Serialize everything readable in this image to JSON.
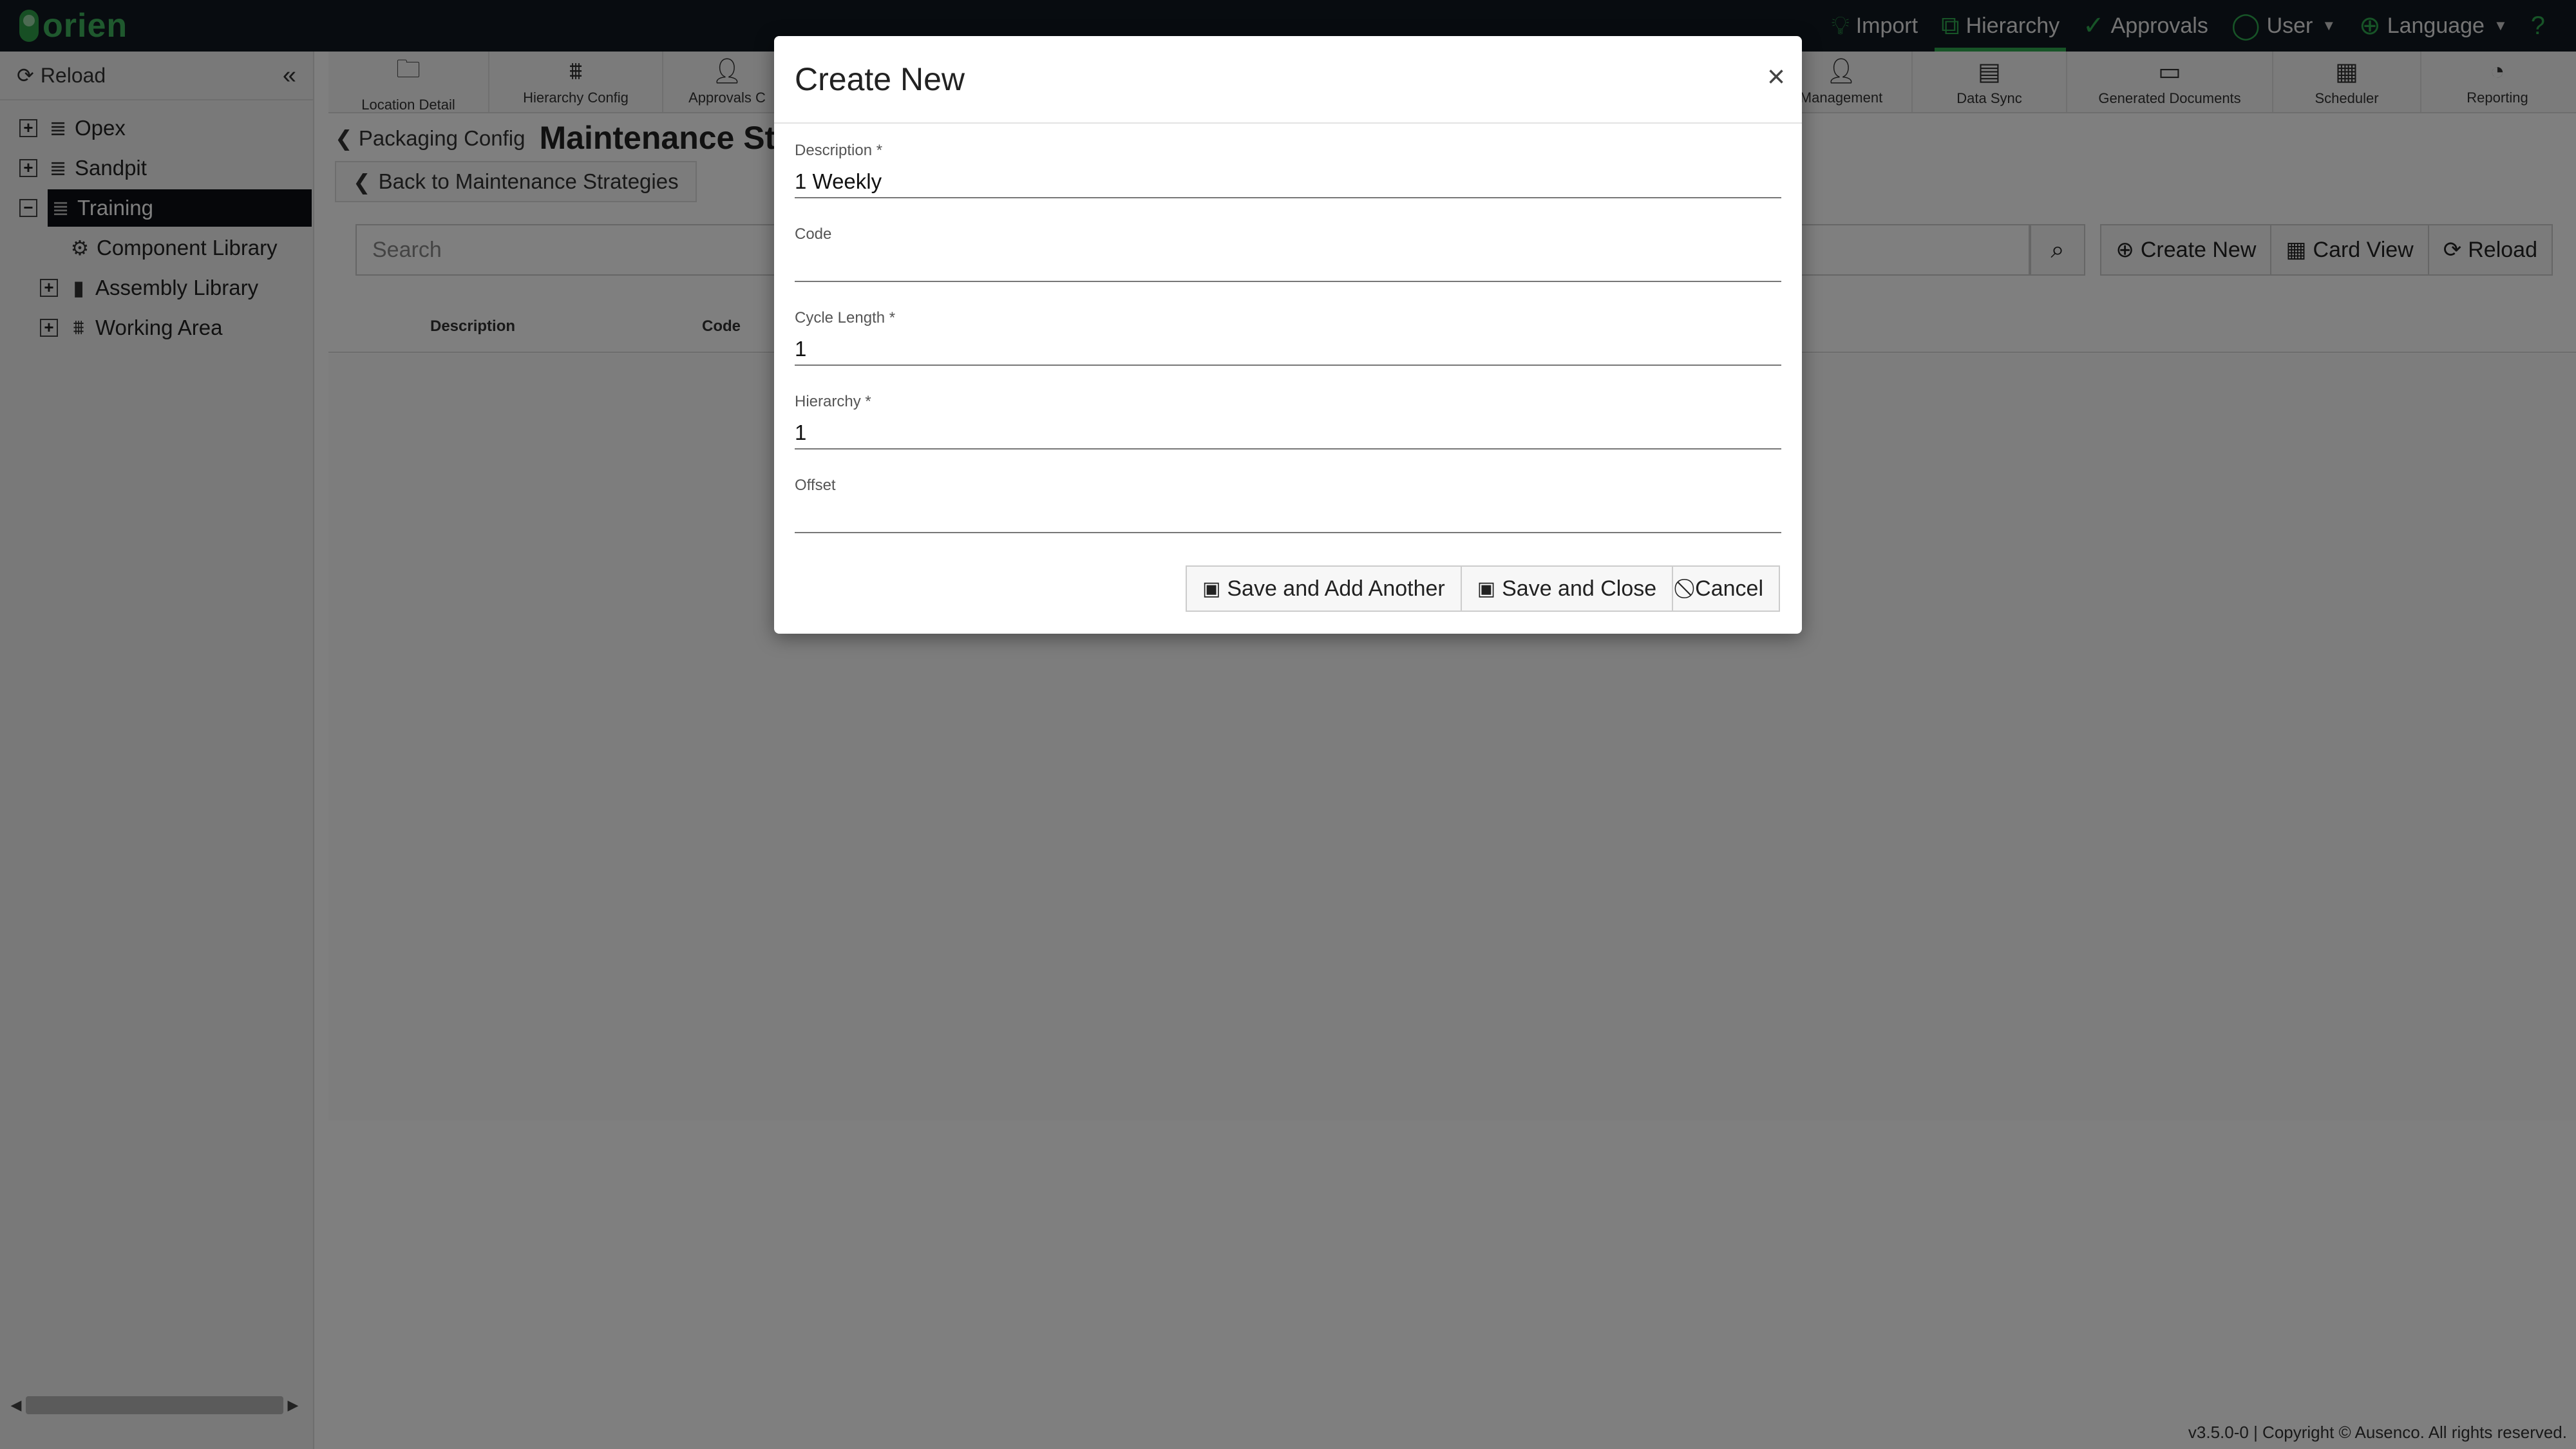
{
  "app": {
    "logo_text": "orien"
  },
  "topnav": [
    {
      "icon": "bulb-icon",
      "label": "Import"
    },
    {
      "icon": "hierarchy-icon",
      "label": "Hierarchy",
      "active": true
    },
    {
      "icon": "check-circle-icon",
      "label": "Approvals"
    },
    {
      "icon": "user-icon",
      "label": "User",
      "dropdown": true
    },
    {
      "icon": "globe-icon",
      "label": "Language",
      "dropdown": true
    },
    {
      "icon": "help-icon",
      "label": ""
    }
  ],
  "sidebar": {
    "reload_label": "Reload",
    "tree": [
      {
        "label": "Opex",
        "toggle": "+",
        "icon": "database-icon",
        "indent": 0
      },
      {
        "label": "Sandpit",
        "toggle": "+",
        "icon": "database-icon",
        "indent": 0
      },
      {
        "label": "Training",
        "toggle": "−",
        "icon": "database-icon",
        "indent": 0,
        "selected": true
      },
      {
        "label": "Component Library",
        "toggle": "",
        "icon": "gear-icon",
        "indent": 1
      },
      {
        "label": "Assembly Library",
        "toggle": "+",
        "icon": "book-icon",
        "indent": 1
      },
      {
        "label": "Working Area",
        "toggle": "+",
        "icon": "sitemap-icon",
        "indent": 1
      }
    ]
  },
  "tabs": [
    {
      "label": "Location Detail",
      "icon": "folder-icon"
    },
    {
      "label": "Hierarchy Config",
      "icon": "sitemap-icon"
    },
    {
      "label": "Approvals C",
      "icon": "user-check-icon"
    },
    {
      "label": "",
      "icon": ""
    },
    {
      "label": "",
      "icon": ""
    },
    {
      "label": "",
      "icon": ""
    },
    {
      "label": "",
      "icon": ""
    },
    {
      "label": "",
      "icon": ""
    },
    {
      "label": "Management",
      "icon": "user-check-icon"
    },
    {
      "label": "Data Sync",
      "icon": "file-sync-icon"
    },
    {
      "label": "Generated Documents",
      "icon": "archive-icon"
    },
    {
      "label": "Scheduler",
      "icon": "calendar-icon"
    },
    {
      "label": "Reporting",
      "icon": "pie-chart-icon"
    }
  ],
  "breadcrumb": {
    "back_label": "Packaging Config",
    "title": "Maintenance Stra"
  },
  "back_button": "Back to Maintenance Strategies",
  "search": {
    "placeholder": "Search"
  },
  "toolbar": {
    "create_new": "Create New",
    "card_view": "Card View",
    "reload": "Reload"
  },
  "table": {
    "headers": [
      "Description",
      "Code"
    ]
  },
  "footer": "v3.5.0-0 | Copyright © Ausenco. All rights reserved.",
  "modal": {
    "title": "Create New",
    "close": "×",
    "fields": [
      {
        "label": "Description *",
        "value": "1 Weekly"
      },
      {
        "label": "Code",
        "value": ""
      },
      {
        "label": "Cycle Length *",
        "value": "1"
      },
      {
        "label": "Hierarchy *",
        "value": "1"
      },
      {
        "label": "Offset",
        "value": ""
      }
    ],
    "buttons": {
      "save_add": "Save and Add Another",
      "save_close": "Save and Close",
      "cancel": "Cancel"
    }
  }
}
